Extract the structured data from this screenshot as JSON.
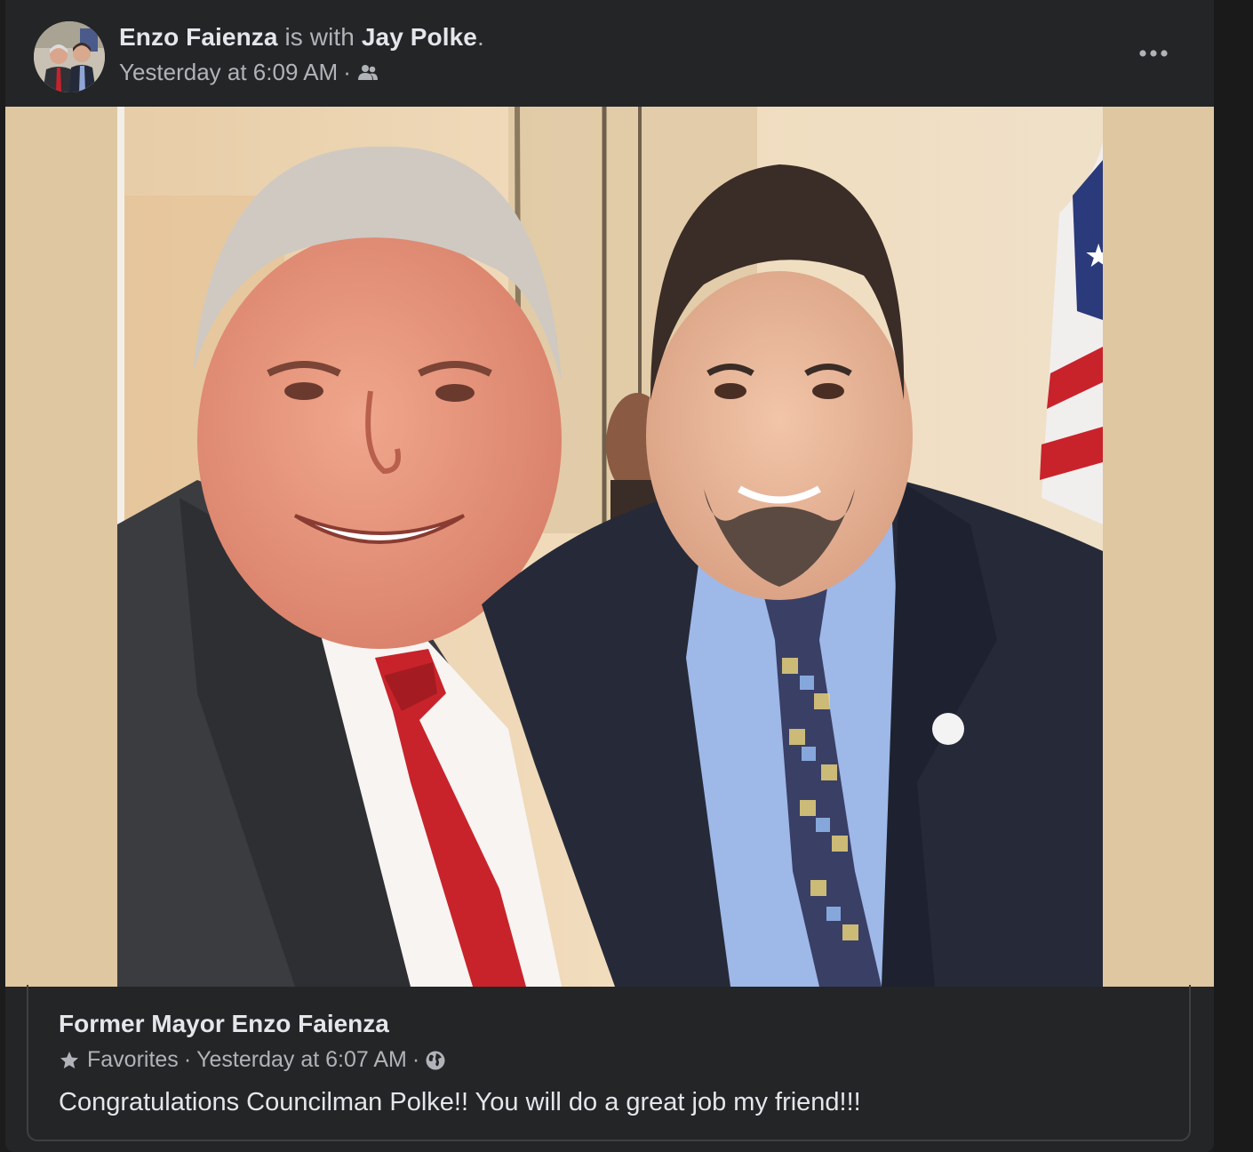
{
  "post": {
    "author_name": "Enzo Faienza",
    "with_text": "is with",
    "tagged_name": "Jay Polke",
    "period": ".",
    "timestamp": "Yesterday at 6:09 AM",
    "separator": "·",
    "audience_icon": "friends-icon",
    "more_icon": "more-options-icon"
  },
  "photo": {
    "subject": "photo"
  },
  "shared_post": {
    "author_name": "Former Mayor Enzo Faienza",
    "list_icon": "star-icon",
    "list_label": "Favorites",
    "separator": "·",
    "timestamp": "Yesterday at 6:07 AM",
    "audience_icon": "globe-icon",
    "text": "Congratulations Councilman Polke!! You will do a great job my friend!!!"
  },
  "colors": {
    "background": "#242526",
    "primary_text": "#e4e6eb",
    "secondary_text": "#b0b3b8",
    "photo_matte": "#dfc7a2"
  }
}
